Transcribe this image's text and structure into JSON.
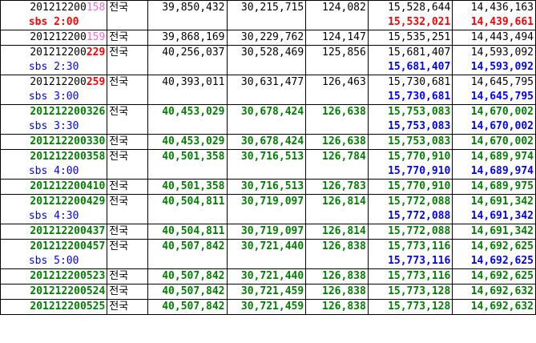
{
  "colors": {
    "black": "#000000",
    "green": "#008000",
    "blue": "#0000ff",
    "red": "#ff0000",
    "pink": "#ff66cc"
  },
  "rows": [
    {
      "kind": "data",
      "style": "black",
      "id_prefix": "201212200",
      "id_suffix": "158",
      "id_suffix_style": "pink",
      "region": "전국",
      "c1": "39,850,432",
      "c2": "30,215,715",
      "c3": "124,082",
      "c4": "15,528,644",
      "c5": "14,436,163"
    },
    {
      "kind": "sbs",
      "style": "red",
      "label": "sbs  2:00",
      "c4": "15,532,021",
      "c5": "14,439,661"
    },
    {
      "kind": "data",
      "style": "black",
      "id_prefix": "201212200",
      "id_suffix": "159",
      "id_suffix_style": "pink",
      "region": "전국",
      "c1": "39,868,169",
      "c2": "30,229,762",
      "c3": "124,147",
      "c4": "15,535,251",
      "c5": "14,443,494"
    },
    {
      "kind": "data",
      "style": "black",
      "id_prefix": "201212200",
      "id_suffix": "229",
      "id_suffix_style": "redid",
      "region": "전국",
      "c1": "40,256,037",
      "c2": "30,528,469",
      "c3": "125,856",
      "c4": "15,681,407",
      "c5": "14,593,092"
    },
    {
      "kind": "sbs",
      "style": "blue",
      "label": "sbs  2:30",
      "c4": "15,681,407",
      "c5": "14,593,092"
    },
    {
      "kind": "data",
      "style": "black",
      "id_prefix": "201212200",
      "id_suffix": "259",
      "id_suffix_style": "redid",
      "region": "전국",
      "c1": "40,393,011",
      "c2": "30,631,477",
      "c3": "126,463",
      "c4": "15,730,681",
      "c5": "14,645,795"
    },
    {
      "kind": "sbs",
      "style": "blue",
      "label": "sbs  3:00",
      "c4": "15,730,681",
      "c5": "14,645,795"
    },
    {
      "kind": "data",
      "style": "green",
      "id_prefix": "201212200326",
      "id_suffix": "",
      "id_suffix_style": "green",
      "region": "전국",
      "c1": "40,453,029",
      "c2": "30,678,424",
      "c3": "126,638",
      "c4": "15,753,083",
      "c5": "14,670,002"
    },
    {
      "kind": "sbs",
      "style": "blue",
      "label": "sbs  3:30",
      "c4": "15,753,083",
      "c5": "14,670,002"
    },
    {
      "kind": "data",
      "style": "green",
      "id_prefix": "201212200330",
      "id_suffix": "",
      "id_suffix_style": "green",
      "region": "전국",
      "c1": "40,453,029",
      "c2": "30,678,424",
      "c3": "126,638",
      "c4": "15,753,083",
      "c5": "14,670,002"
    },
    {
      "kind": "data",
      "style": "green",
      "id_prefix": "201212200358",
      "id_suffix": "",
      "id_suffix_style": "green",
      "region": "전국",
      "c1": "40,501,358",
      "c2": "30,716,513",
      "c3": "126,784",
      "c4": "15,770,910",
      "c5": "14,689,974"
    },
    {
      "kind": "sbs",
      "style": "blue",
      "label": "sbs  4:00",
      "c4": "15,770,910",
      "c5": "14,689,974"
    },
    {
      "kind": "data",
      "style": "green",
      "id_prefix": "201212200410",
      "id_suffix": "",
      "id_suffix_style": "green",
      "region": "전국",
      "c1": "40,501,358",
      "c2": "30,716,513",
      "c3": "126,783",
      "c4": "15,770,910",
      "c5": "14,689,975"
    },
    {
      "kind": "data",
      "style": "green",
      "id_prefix": "201212200429",
      "id_suffix": "",
      "id_suffix_style": "green",
      "region": "전국",
      "c1": "40,504,811",
      "c2": "30,719,097",
      "c3": "126,814",
      "c4": "15,772,088",
      "c5": "14,691,342"
    },
    {
      "kind": "sbs",
      "style": "blue",
      "label": "sbs  4:30",
      "c4": "15,772,088",
      "c5": "14,691,342"
    },
    {
      "kind": "data",
      "style": "green",
      "id_prefix": "201212200437",
      "id_suffix": "",
      "id_suffix_style": "green",
      "region": "전국",
      "c1": "40,504,811",
      "c2": "30,719,097",
      "c3": "126,814",
      "c4": "15,772,088",
      "c5": "14,691,342"
    },
    {
      "kind": "data",
      "style": "green",
      "id_prefix": "201212200457",
      "id_suffix": "",
      "id_suffix_style": "green",
      "region": "전국",
      "c1": "40,507,842",
      "c2": "30,721,440",
      "c3": "126,838",
      "c4": "15,773,116",
      "c5": "14,692,625"
    },
    {
      "kind": "sbs",
      "style": "blue",
      "label": "sbs  5:00",
      "c4": "15,773,116",
      "c5": "14,692,625"
    },
    {
      "kind": "data",
      "style": "green",
      "id_prefix": "201212200523",
      "id_suffix": "",
      "id_suffix_style": "green",
      "region": "전국",
      "c1": "40,507,842",
      "c2": "30,721,440",
      "c3": "126,838",
      "c4": "15,773,116",
      "c5": "14,692,625"
    },
    {
      "kind": "data",
      "style": "green",
      "id_prefix": "201212200524",
      "id_suffix": "",
      "id_suffix_style": "green",
      "region": "전국",
      "c1": "40,507,842",
      "c2": "30,721,459",
      "c3": "126,838",
      "c4": "15,773,128",
      "c5": "14,692,632"
    },
    {
      "kind": "data",
      "style": "green",
      "id_prefix": "201212200525",
      "id_suffix": "",
      "id_suffix_style": "green",
      "region": "전국",
      "c1": "40,507,842",
      "c2": "30,721,459",
      "c3": "126,838",
      "c4": "15,773,128",
      "c5": "14,692,632"
    }
  ]
}
